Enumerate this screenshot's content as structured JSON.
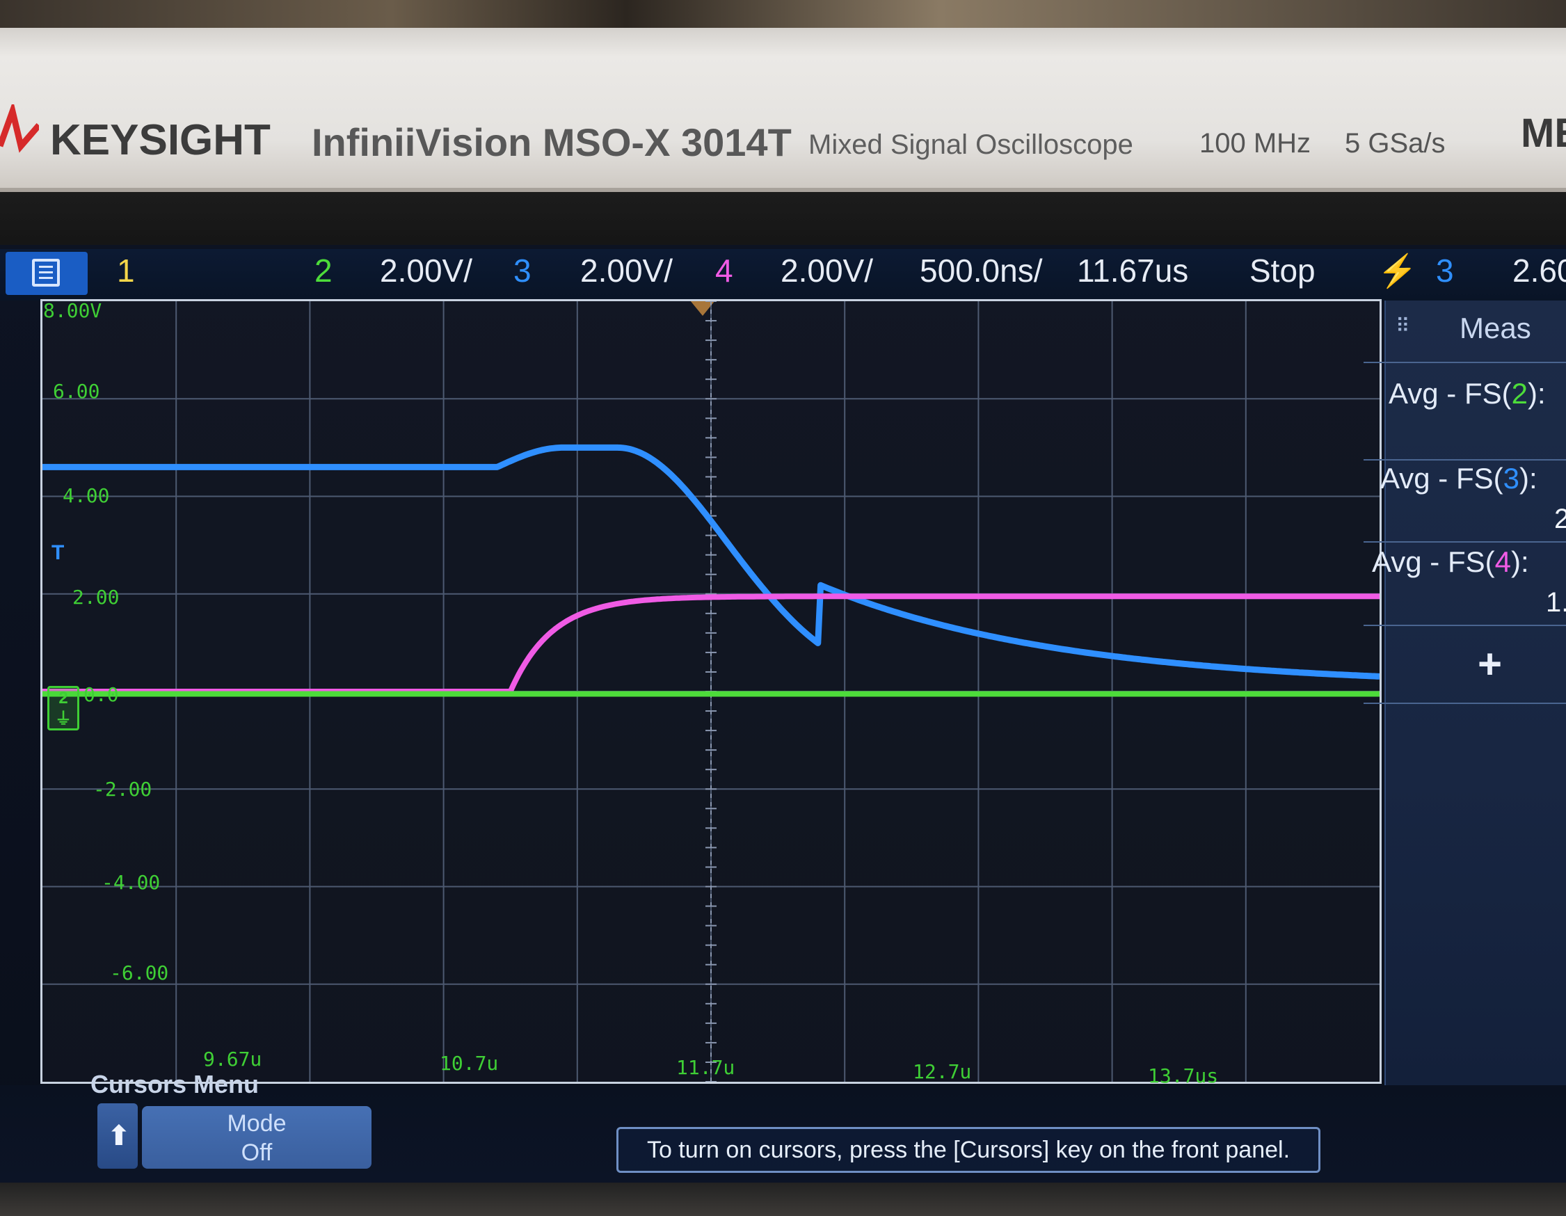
{
  "brand": {
    "name": "KEYSIGHT",
    "model": "InfiniiVision MSO-X 3014T",
    "description": "Mixed Signal Oscilloscope",
    "bandwidth": "100 MHz",
    "sample_rate": "5 GSa/s",
    "cut_label": "ME"
  },
  "status_bar": {
    "ch1_label": "1",
    "ch2_label": "2",
    "ch2_scale": "2.00V/",
    "ch3_label": "3",
    "ch3_scale": "2.00V/",
    "ch4_label": "4",
    "ch4_scale": "2.00V/",
    "timebase": "500.0ns/",
    "delay": "11.67us",
    "run_state": "Stop",
    "trigger_source": "3",
    "trigger_level_cut": "2.60"
  },
  "graticule": {
    "y_labels": [
      "8.00V",
      "6.00",
      "4.00",
      "2.00",
      "0.0",
      "-2.00",
      "-4.00",
      "-6.00"
    ],
    "x_labels": [
      "9.67u",
      "10.7u",
      "11.7u",
      "12.7u",
      "13.7us"
    ],
    "ground_marker": "2",
    "trigger_marker": "T"
  },
  "measurements": {
    "title": "Meas",
    "grip": "⠿",
    "items": [
      {
        "prefix": "Avg - FS(",
        "channel": "2",
        "suffix": "):",
        "value": ""
      },
      {
        "prefix": "Avg - FS(",
        "channel": "3",
        "suffix": "):",
        "value": "2"
      },
      {
        "prefix": "Avg - FS(",
        "channel": "4",
        "suffix": "):",
        "value": "1."
      }
    ],
    "add_label": "+"
  },
  "cursors_menu": {
    "title": "Cursors Menu",
    "back_icon": "up-arrow-icon",
    "mode_label": "Mode",
    "mode_value": "Off",
    "hint": "To turn on cursors, press the [Cursors] key on the front panel."
  },
  "colors": {
    "ch1": "#f4d64a",
    "ch2": "#4ddc3a",
    "ch3": "#2f8fff",
    "ch4": "#f05be5",
    "trigger": "#f3a544"
  }
}
